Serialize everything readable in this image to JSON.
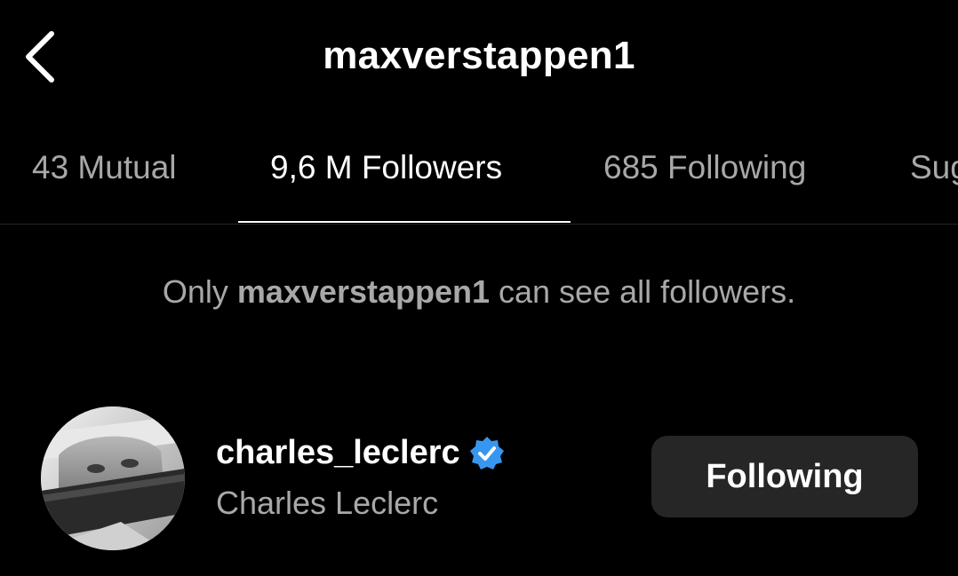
{
  "header": {
    "title": "maxverstappen1",
    "back_icon": "chevron-left-icon"
  },
  "tabs": [
    {
      "label": "43 Mutual",
      "active": false
    },
    {
      "label": "9,6 M Followers",
      "active": true
    },
    {
      "label": "685 Following",
      "active": false
    },
    {
      "label": "Sug",
      "active": false
    }
  ],
  "notice": {
    "prefix": "Only ",
    "username": "maxverstappen1",
    "suffix": " can see all followers."
  },
  "followers": [
    {
      "username": "charles_leclerc",
      "full_name": "Charles Leclerc",
      "verified": true,
      "button_label": "Following"
    }
  ],
  "colors": {
    "background": "#000000",
    "primary_text": "#ffffff",
    "secondary_text": "#a8a8a8",
    "button_bg": "#262626",
    "verified_badge": "#3797f0",
    "divider": "#262626"
  }
}
